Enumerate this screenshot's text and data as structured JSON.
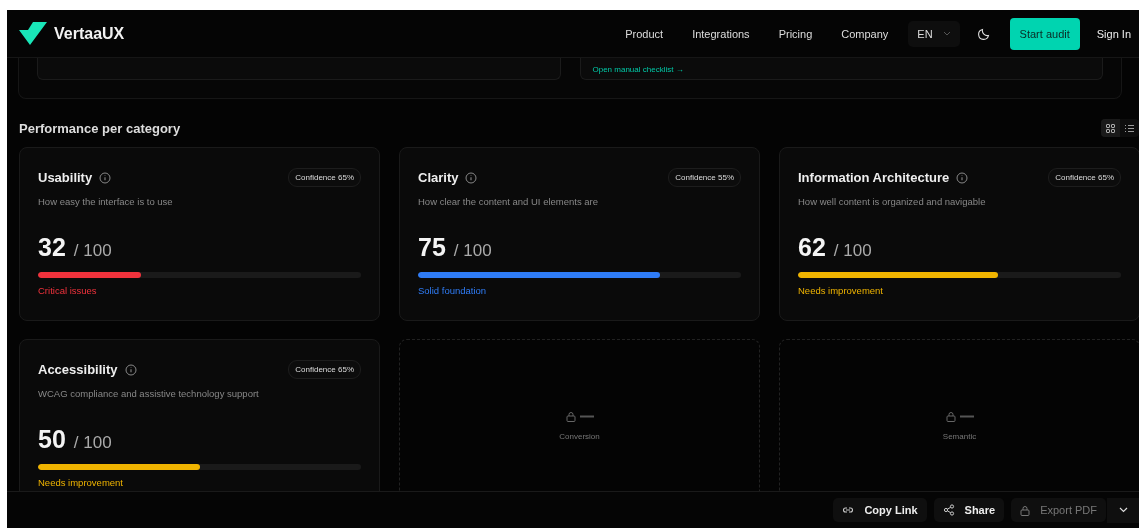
{
  "header": {
    "brand": "VertaaUX",
    "nav": [
      "Product",
      "Integrations",
      "Pricing",
      "Company"
    ],
    "language": "EN",
    "cta": "Start audit",
    "sign_in": "Sign In"
  },
  "upper": {
    "link": "Open manual checklist →"
  },
  "section": {
    "title": "Performance per category",
    "views": [
      {
        "kind": "grid",
        "selected": true
      },
      {
        "kind": "list",
        "selected": false
      }
    ]
  },
  "cards": [
    {
      "kind": "score",
      "title": "Usability",
      "confidence": "Confidence 65%",
      "description": "How easy the interface is to use",
      "score": "32",
      "max": "/ 100",
      "level": 0.32,
      "status": "Critical issues",
      "color": "#f0323c"
    },
    {
      "kind": "score",
      "title": "Clarity",
      "confidence": "Confidence 55%",
      "description": "How clear the content and UI elements are",
      "score": "75",
      "max": "/ 100",
      "level": 0.75,
      "status": "Solid foundation",
      "color": "#2f7cf6"
    },
    {
      "kind": "score",
      "title": "Information Architecture",
      "confidence": "Confidence 65%",
      "description": "How well content is organized and navigable",
      "score": "62",
      "max": "/ 100",
      "level": 0.62,
      "status": "Needs improvement",
      "color": "#f0b400"
    },
    {
      "kind": "score",
      "title": "Accessibility",
      "confidence": "Confidence 65%",
      "description": "WCAG compliance and assistive technology support",
      "score": "50",
      "max": "/ 100",
      "level": 0.5,
      "status": "Needs improvement",
      "color": "#f0b400"
    },
    {
      "kind": "locked",
      "title": "Conversion"
    },
    {
      "kind": "locked",
      "title": "Semantic"
    }
  ],
  "actions": [
    {
      "kind": "link",
      "label": "Copy Link",
      "disabled": false
    },
    {
      "kind": "share",
      "label": "Share",
      "disabled": false
    },
    {
      "kind": "lock",
      "label": "Export PDF",
      "disabled": true
    }
  ]
}
